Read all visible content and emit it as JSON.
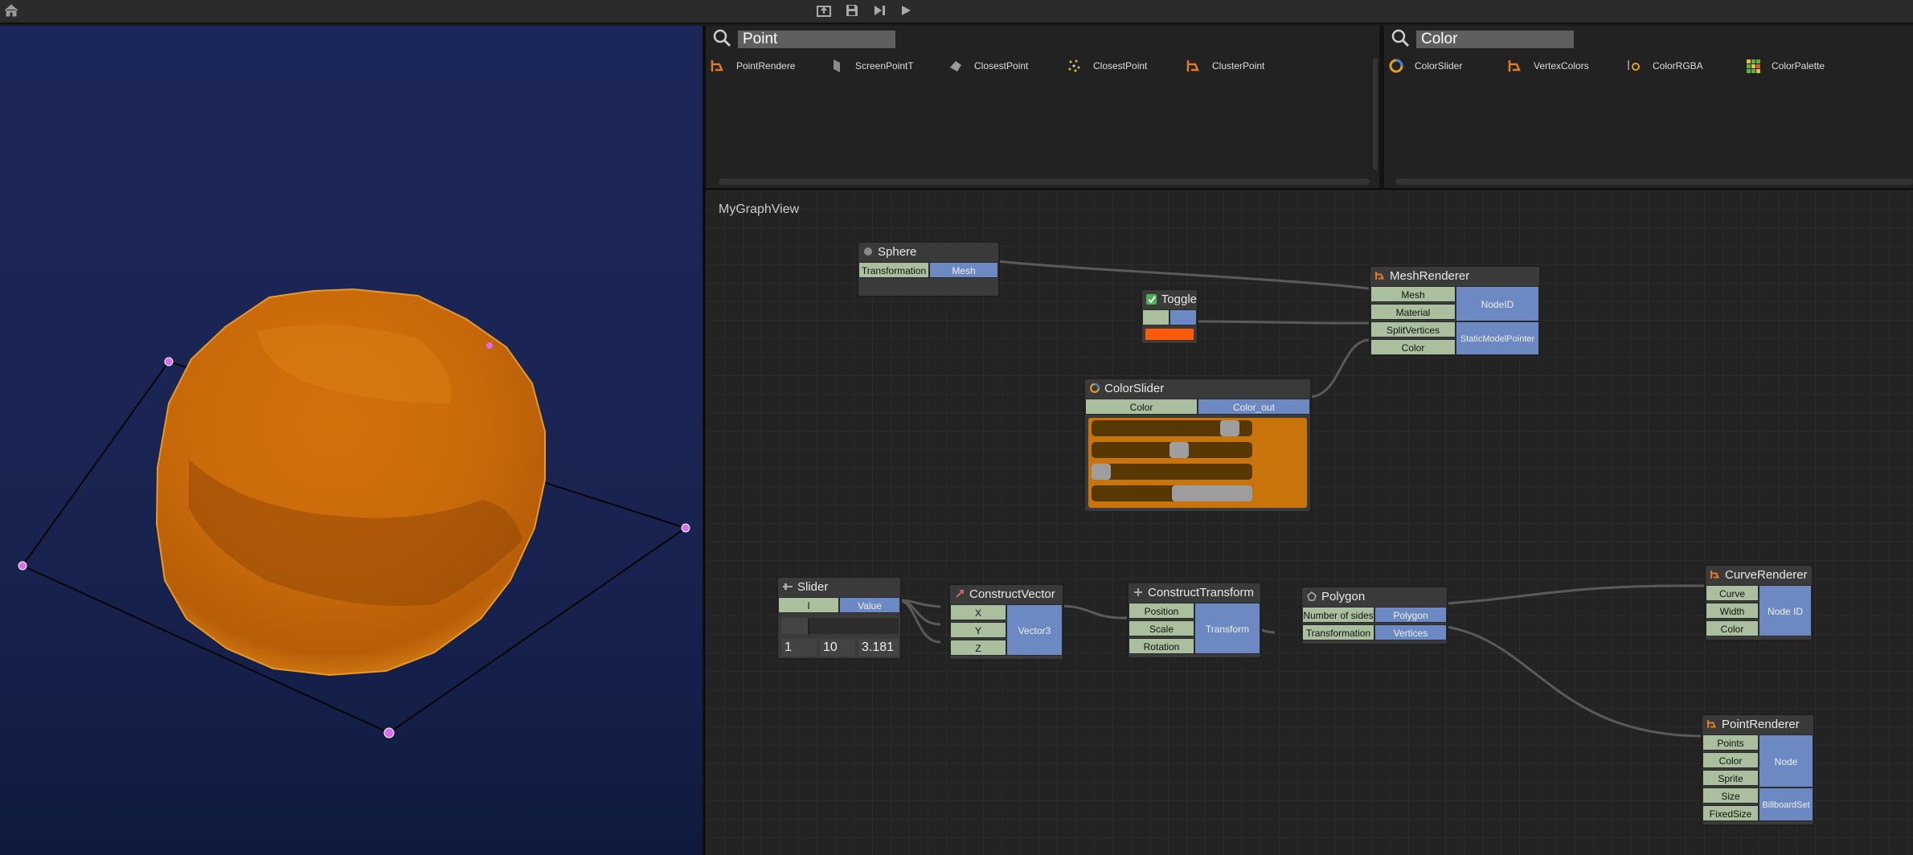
{
  "toolbar": {
    "home": "home-icon",
    "export": "export-icon",
    "save": "save-icon",
    "step": "step-icon",
    "play": "play-icon"
  },
  "search_left": {
    "query": "Point",
    "results": [
      {
        "label": "PointRendere",
        "icon": "renderer-icon"
      },
      {
        "label": "ScreenPointT",
        "icon": "screen-point-icon"
      },
      {
        "label": "ClosestPoint",
        "icon": "closest-point-icon"
      },
      {
        "label": "ClosestPoint",
        "icon": "closest-point-dots-icon"
      },
      {
        "label": "ClusterPoint",
        "icon": "renderer-icon"
      }
    ]
  },
  "search_right": {
    "query": "Color",
    "results": [
      {
        "label": "ColorSlider",
        "icon": "color-wheel-icon"
      },
      {
        "label": "VertexColors",
        "icon": "renderer-icon"
      },
      {
        "label": "ColorRGBA",
        "icon": "color-rgba-icon"
      },
      {
        "label": "ColorPalette",
        "icon": "palette-icon"
      }
    ]
  },
  "graph": {
    "title": "MyGraphView",
    "nodes": {
      "sphere": {
        "title": "Sphere",
        "in": [
          "Transformation"
        ],
        "out": [
          "Mesh"
        ]
      },
      "meshrenderer": {
        "title": "MeshRenderer",
        "in": [
          "Mesh",
          "Material",
          "SplitVertices",
          "Color"
        ],
        "out": [
          "NodeID",
          "StaticModelPointer"
        ]
      },
      "toggle": {
        "title": "Toggle",
        "value_color": "#ff5a0a"
      },
      "colorslider": {
        "title": "ColorSlider",
        "in": [
          "Color"
        ],
        "out": [
          "Color_out"
        ],
        "swatch": "#c9740a",
        "channels": [
          0.91,
          0.55,
          0.0,
          1.0
        ]
      },
      "slider": {
        "title": "Slider",
        "in": [
          "I"
        ],
        "out": [
          "Value"
        ],
        "min": "1",
        "max": "10",
        "value": "3.181"
      },
      "constructvector": {
        "title": "ConstructVector",
        "in": [
          "X",
          "Y",
          "Z"
        ],
        "out": [
          "Vector3"
        ]
      },
      "constructtransform": {
        "title": "ConstructTransform",
        "in": [
          "Position",
          "Scale",
          "Rotation"
        ],
        "out": [
          "Transform"
        ]
      },
      "polygon": {
        "title": "Polygon",
        "in": [
          "Number of sides",
          "Transformation"
        ],
        "out": [
          "Polygon",
          "Vertices"
        ]
      },
      "curverenderer": {
        "title": "CurveRenderer",
        "in": [
          "Curve",
          "Width",
          "Color"
        ],
        "out": [
          "Node ID"
        ]
      },
      "pointrenderer": {
        "title": "PointRenderer",
        "in": [
          "Points",
          "Color",
          "Sprite",
          "Size",
          "FixedSize"
        ],
        "out": [
          "Node",
          "BillboardSet"
        ]
      }
    }
  },
  "colors": {
    "sphere": "#d9760f",
    "point_marker": "#d96cf0",
    "port_in": "#a9bf9e",
    "port_out": "#6d89c3"
  }
}
